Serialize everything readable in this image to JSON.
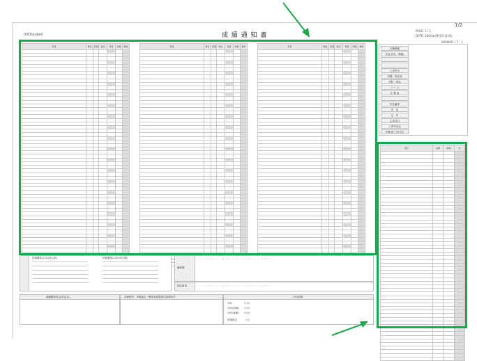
{
  "header": {
    "left_code": "(OOkoukei)",
    "title": "成 績 通 知 書",
    "page": "1/2",
    "meta_line1": "PAGE:    1 / 1",
    "meta_line2": "DATE: 2005年09月01日(木)",
    "meta_line3": "0000001 / 1 - 1"
  },
  "main_table": {
    "columns": [
      "科目",
      "単位",
      "評価",
      "得点",
      "年度",
      "学期",
      "備考"
    ]
  },
  "right_panel": {
    "items": [
      "在籍情報",
      "氏名(氏名・情報)",
      "",
      "",
      "入学年次",
      "学籍・所在地",
      "学科・専攻",
      "コ ー ス",
      "在 籍 者",
      "",
      "学生番号",
      "氏　名",
      "生　年",
      "生年月日",
      "入学年月日",
      "卒業(修了)年月日"
    ]
  },
  "right_table": {
    "columns": [
      "区分",
      "必要",
      "修得",
      "計"
    ]
  },
  "bottom": {
    "legend_title_a": "評価基準(2004年以前)",
    "legend_title_b": "評価基準(2005年以降)",
    "remarks_label": "備考欄",
    "remarks_dots": "・・・・・・・・・・・・・・・・・・・・・・・・・・・・・・・",
    "special_label": "特記事項",
    "special_dots": "・・・・・・・・・・・・・・・・・・・・・・・・・・・・・・・",
    "section1": "補講履修科目(科目名)",
    "section2": "卒業研究・卒業論文・教育実習等単位修得状況",
    "section3": "GPA評価",
    "gpa_rows": [
      "GPA",
      "GPA(前期)",
      "GPA(後期)"
    ],
    "gpa_vals": [
      "3.00",
      "2.95",
      "3.05"
    ],
    "credit_label": "修得単位",
    "credit_val": "1.0"
  },
  "colors": {
    "highlight": "#1ea64a"
  }
}
